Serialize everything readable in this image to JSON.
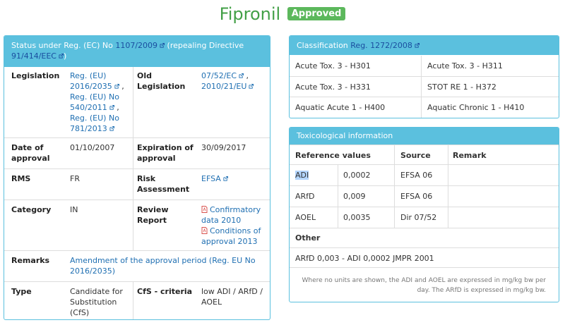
{
  "page": {
    "title": "Fipronil",
    "badge": "Approved"
  },
  "status": {
    "header_prefix": "Status under Reg. (EC) No ",
    "header_link1": "1107/2009",
    "header_mid": " (repealing Directive ",
    "header_link2": "91/414/EEC",
    "header_suffix": ")",
    "legislation_label": "Legislation",
    "legislation_links": [
      "Reg. (EU)",
      "2016/2035",
      ",",
      "Reg. (EU) No",
      "540/2011",
      ",",
      "Reg. (EU) No",
      "781/2013"
    ],
    "old_legislation_label": [
      "Old",
      "Legislation"
    ],
    "old_legislation_links": [
      "07/52/EC",
      ",",
      "2010/21/EU"
    ],
    "date_label": [
      "Date of",
      "approval"
    ],
    "date_value": "01/10/2007",
    "expiration_label": [
      "Expiration of",
      "approval"
    ],
    "expiration_value": "30/09/2017",
    "rms_label": "RMS",
    "rms_value": "FR",
    "risk_label": [
      "Risk",
      "Assessment"
    ],
    "risk_value": "EFSA",
    "category_label": "Category",
    "category_value": "IN",
    "review_label": [
      "Review",
      "Report"
    ],
    "review_items": [
      [
        "Confirmatory",
        "data 2010"
      ],
      [
        "Conditions of",
        "approval 2013"
      ]
    ],
    "remarks_label": "Remarks",
    "remarks_value": [
      "Amendment of the approval period (Reg. EU No",
      "2016/2035)"
    ],
    "type_label": "Type",
    "type_value": [
      "Candidate for",
      "Substitution",
      "(CfS)"
    ],
    "cfs_label": "CfS - criteria",
    "cfs_value": [
      "low ADI / ARfD /",
      "AOEL"
    ]
  },
  "classification": {
    "header_prefix": "Classification ",
    "header_link": "Reg. 1272/2008",
    "rows": [
      [
        "Acute Tox. 3 - H301",
        "Acute Tox. 3 - H311"
      ],
      [
        "Acute Tox. 3 - H331",
        "STOT RE 1 - H372"
      ],
      [
        "Aquatic Acute 1 - H400",
        "Aquatic Chronic 1 - H410"
      ]
    ]
  },
  "tox": {
    "header": "Toxicological information",
    "columns": [
      "Reference values",
      "Source",
      "Remark"
    ],
    "rows": [
      {
        "name": "ADI",
        "value": "0,0002",
        "source": "EFSA 06",
        "remark": ""
      },
      {
        "name": "ARfD",
        "value": "0,009",
        "source": "EFSA 06",
        "remark": ""
      },
      {
        "name": "AOEL",
        "value": "0,0035",
        "source": "Dir 07/52",
        "remark": ""
      }
    ],
    "other_label": "Other",
    "other_value": "ARfD 0,003 - ADI 0,0002 JMPR 2001",
    "footnote": [
      "Where no units are shown, the ADI and AOEL are expressed in mg/kg bw per",
      "day. The ARfD is expressed in mg/kg bw."
    ]
  }
}
